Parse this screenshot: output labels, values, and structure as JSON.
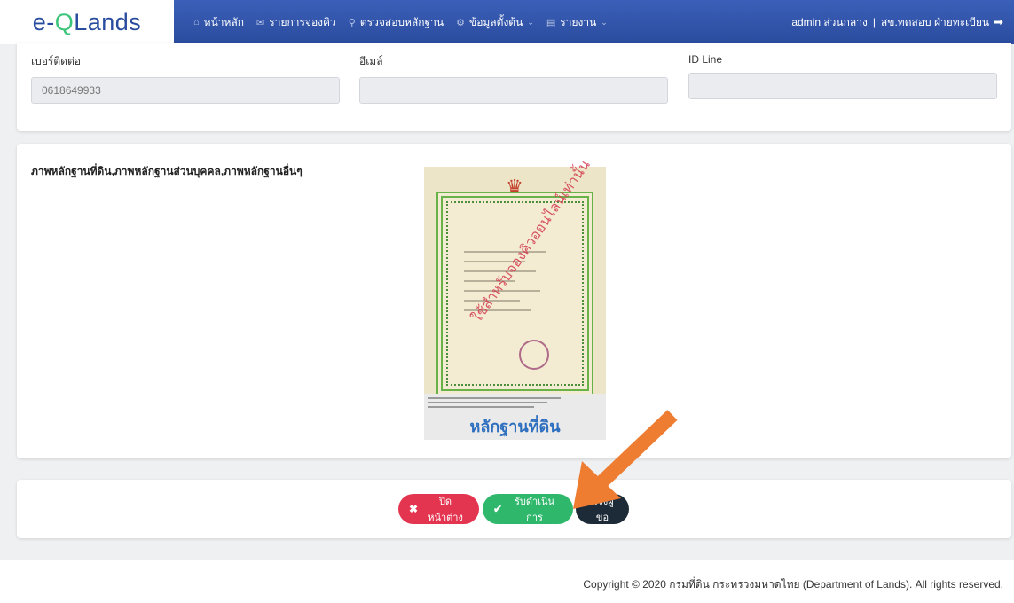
{
  "navbar": {
    "brand_prefix": "e-",
    "brand_q": "Q",
    "brand_suffix": "Lands",
    "items": [
      {
        "label": "หน้าหลัก",
        "icon": "home-icon",
        "has_dropdown": false
      },
      {
        "label": "รายการจองคิว",
        "icon": "mail-icon",
        "has_dropdown": false
      },
      {
        "label": "ตรวจสอบหลักฐาน",
        "icon": "search-icon",
        "has_dropdown": false
      },
      {
        "label": "ข้อมูลตั้งต้น",
        "icon": "settings-icon",
        "has_dropdown": true
      },
      {
        "label": "รายงาน",
        "icon": "report-icon",
        "has_dropdown": true
      }
    ],
    "user_name": "admin ส่วนกลาง",
    "separator": "|",
    "user_office": "สข.ทดสอบ ฝ่ายทะเบียน"
  },
  "contact": {
    "phone_label": "เบอร์ติดต่อ",
    "phone_value": "0618649933",
    "email_label": "อีเมล์",
    "email_value": "",
    "line_label": "ID Line",
    "line_value": ""
  },
  "documents": {
    "title": "ภาพหลักฐานที่ดิน,ภาพหลักฐานส่วนบุคคล,ภาพหลักฐานอื่นๆ",
    "thumb_caption": "หลักฐานที่ดิน",
    "thumb_watermark": "ใช้สำหรับจองคิวออนไลน์เท่านั้น"
  },
  "actions": {
    "close_label": "ปิดหน้าต่าง",
    "accept_label": "รับดำเนินการ",
    "notify_label": "แจ้งผู้ขอ"
  },
  "footer": {
    "copyright": "Copyright © 2020 กรมที่ดิน กระทรวงมหาดไทย (Department of Lands). All rights reserved."
  },
  "colors": {
    "navbar": "#2a4c9e",
    "close": "#e43550",
    "accept": "#2fb86c",
    "notify": "#1d2b38",
    "arrow": "#ee7d32"
  }
}
